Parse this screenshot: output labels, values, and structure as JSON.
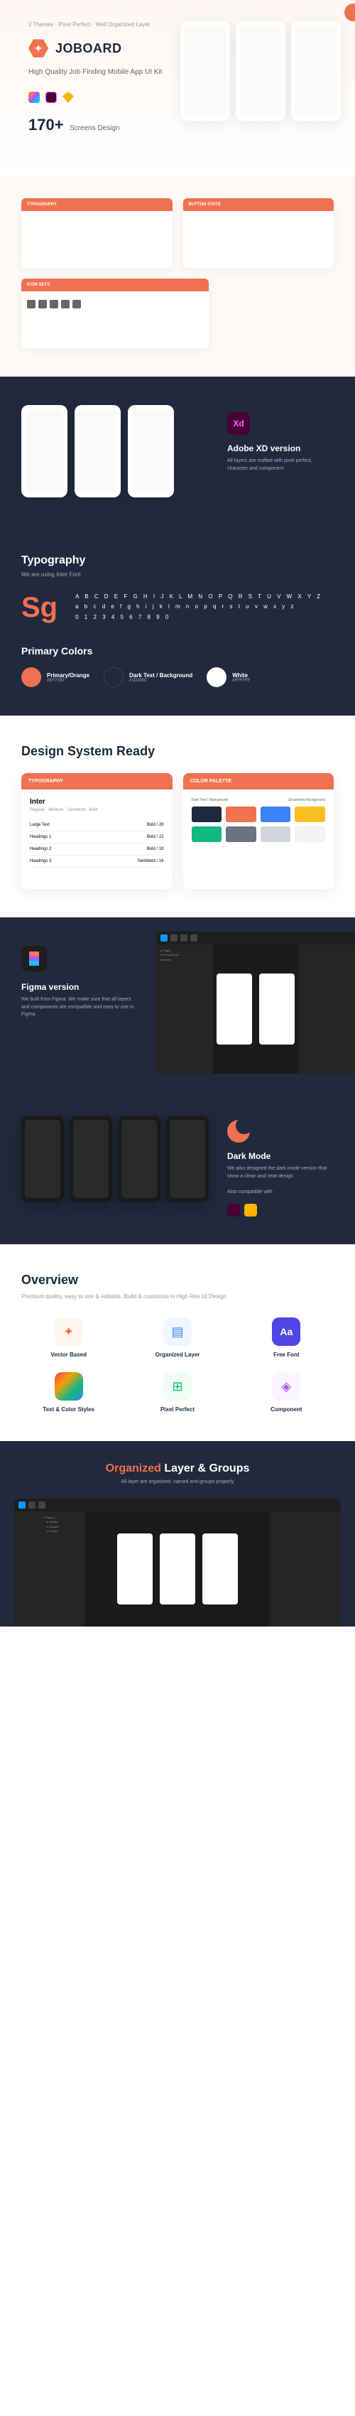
{
  "hero": {
    "tagline": "2 Themes · Pixel Perfect · Well Organized Layer",
    "brand": "JOBOARD",
    "subtitle": "High Quality Job Finding Mobile App UI Kit",
    "stat_number": "170+",
    "stat_label": "Screens Design"
  },
  "style_guide": {
    "card1_title": "TYPOGRAPHY",
    "card2_title": "BUTTON STATE",
    "card3_title": "ICON SETS"
  },
  "xd": {
    "title": "Adobe XD version",
    "desc": "All layers are crafted with pixel perfect, character and component"
  },
  "typography": {
    "title": "Typography",
    "subtitle": "We are using Inter Font",
    "specimen": "Sg",
    "alphabet_upper": "A B C D E F G H I J K L M N O P Q R S T U V W X Y Z",
    "alphabet_lower": "a b c d e f g h i j k l m n o p q r s t u v w x y z",
    "numbers": "0 1 2 3 4 5 6 7 8 9 0"
  },
  "colors": {
    "title": "Primary Colors",
    "items": [
      {
        "name": "Primary/Orange",
        "hex": "#EF7150",
        "swatch": "#ef7150"
      },
      {
        "name": "Dark Text / Background",
        "hex": "#1D293C",
        "swatch": "#1d293c"
      },
      {
        "name": "White",
        "hex": "#FFFFFF",
        "swatch": "#ffffff"
      }
    ]
  },
  "design_system": {
    "title": "Design System Ready",
    "typography_card": {
      "header": "TYPOGRAPHY",
      "font_name": "Inter",
      "weights": "Regular · Medium · Semibold · Bold",
      "rows": [
        {
          "label": "Large Text",
          "value": "Bold / 28"
        },
        {
          "label": "Headings 1",
          "value": "Bold / 22"
        },
        {
          "label": "Headings 2",
          "value": "Bold / 18"
        },
        {
          "label": "Headings 3",
          "value": "Semibold / 16"
        }
      ]
    },
    "palette_card": {
      "header": "COLOR PALETTE",
      "row1_label": "Dark Text / Background",
      "row2_label": "Secondary Background",
      "swatches": [
        "#1d293c",
        "#ef7150",
        "#3b82f6",
        "#fbbf24",
        "#10b981",
        "#6b7280",
        "#d1d5db",
        "#f3f4f6"
      ]
    }
  },
  "figma": {
    "title": "Figma version",
    "desc": "We built from Figma. We make sure that all layers and components are compatible and easy to use in Figma."
  },
  "dark_mode": {
    "title": "Dark Mode",
    "desc": "We also designed the dark mode version that show a clean and neat design.",
    "compat_label": "Also compatible with"
  },
  "overview": {
    "title": "Overview",
    "subtitle": "Premium quality, easy to use & editable. Build & customize in High Res UI Design",
    "features": [
      {
        "label": "Vector Based",
        "bg": "#fff7ed",
        "icon": "✦"
      },
      {
        "label": "Organized Layer",
        "bg": "#eff6ff",
        "icon": "▤"
      },
      {
        "label": "Free Font",
        "bg": "#eef2ff",
        "icon": "Aa"
      },
      {
        "label": "Text & Color Styles",
        "bg": "#fce7f3",
        "icon": "◑"
      },
      {
        "label": "Pixel Perfect",
        "bg": "#f0fdf4",
        "icon": "⊞"
      },
      {
        "label": "Component",
        "bg": "#faf5ff",
        "icon": "◈"
      }
    ]
  },
  "organized": {
    "title_a": "Organized ",
    "title_b": "Layer & Groups",
    "subtitle": "All layer are organized, named and groups properly"
  }
}
